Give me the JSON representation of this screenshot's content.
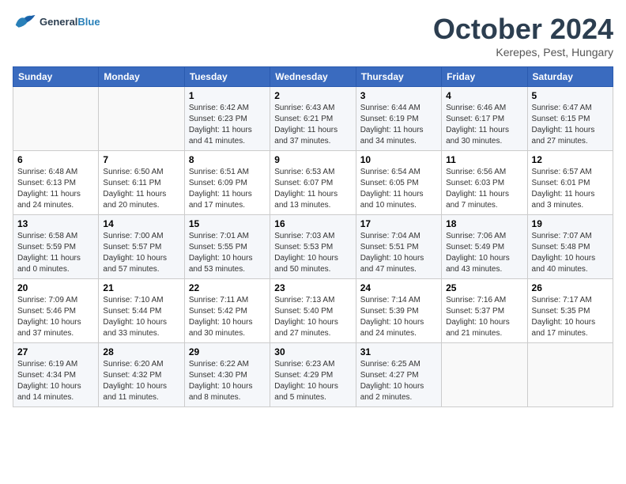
{
  "header": {
    "logo_general": "General",
    "logo_blue": "Blue",
    "month": "October 2024",
    "location": "Kerepes, Pest, Hungary"
  },
  "weekdays": [
    "Sunday",
    "Monday",
    "Tuesday",
    "Wednesday",
    "Thursday",
    "Friday",
    "Saturday"
  ],
  "weeks": [
    [
      {
        "day": "",
        "details": ""
      },
      {
        "day": "",
        "details": ""
      },
      {
        "day": "1",
        "details": "Sunrise: 6:42 AM\nSunset: 6:23 PM\nDaylight: 11 hours and 41 minutes."
      },
      {
        "day": "2",
        "details": "Sunrise: 6:43 AM\nSunset: 6:21 PM\nDaylight: 11 hours and 37 minutes."
      },
      {
        "day": "3",
        "details": "Sunrise: 6:44 AM\nSunset: 6:19 PM\nDaylight: 11 hours and 34 minutes."
      },
      {
        "day": "4",
        "details": "Sunrise: 6:46 AM\nSunset: 6:17 PM\nDaylight: 11 hours and 30 minutes."
      },
      {
        "day": "5",
        "details": "Sunrise: 6:47 AM\nSunset: 6:15 PM\nDaylight: 11 hours and 27 minutes."
      }
    ],
    [
      {
        "day": "6",
        "details": "Sunrise: 6:48 AM\nSunset: 6:13 PM\nDaylight: 11 hours and 24 minutes."
      },
      {
        "day": "7",
        "details": "Sunrise: 6:50 AM\nSunset: 6:11 PM\nDaylight: 11 hours and 20 minutes."
      },
      {
        "day": "8",
        "details": "Sunrise: 6:51 AM\nSunset: 6:09 PM\nDaylight: 11 hours and 17 minutes."
      },
      {
        "day": "9",
        "details": "Sunrise: 6:53 AM\nSunset: 6:07 PM\nDaylight: 11 hours and 13 minutes."
      },
      {
        "day": "10",
        "details": "Sunrise: 6:54 AM\nSunset: 6:05 PM\nDaylight: 11 hours and 10 minutes."
      },
      {
        "day": "11",
        "details": "Sunrise: 6:56 AM\nSunset: 6:03 PM\nDaylight: 11 hours and 7 minutes."
      },
      {
        "day": "12",
        "details": "Sunrise: 6:57 AM\nSunset: 6:01 PM\nDaylight: 11 hours and 3 minutes."
      }
    ],
    [
      {
        "day": "13",
        "details": "Sunrise: 6:58 AM\nSunset: 5:59 PM\nDaylight: 11 hours and 0 minutes."
      },
      {
        "day": "14",
        "details": "Sunrise: 7:00 AM\nSunset: 5:57 PM\nDaylight: 10 hours and 57 minutes."
      },
      {
        "day": "15",
        "details": "Sunrise: 7:01 AM\nSunset: 5:55 PM\nDaylight: 10 hours and 53 minutes."
      },
      {
        "day": "16",
        "details": "Sunrise: 7:03 AM\nSunset: 5:53 PM\nDaylight: 10 hours and 50 minutes."
      },
      {
        "day": "17",
        "details": "Sunrise: 7:04 AM\nSunset: 5:51 PM\nDaylight: 10 hours and 47 minutes."
      },
      {
        "day": "18",
        "details": "Sunrise: 7:06 AM\nSunset: 5:49 PM\nDaylight: 10 hours and 43 minutes."
      },
      {
        "day": "19",
        "details": "Sunrise: 7:07 AM\nSunset: 5:48 PM\nDaylight: 10 hours and 40 minutes."
      }
    ],
    [
      {
        "day": "20",
        "details": "Sunrise: 7:09 AM\nSunset: 5:46 PM\nDaylight: 10 hours and 37 minutes."
      },
      {
        "day": "21",
        "details": "Sunrise: 7:10 AM\nSunset: 5:44 PM\nDaylight: 10 hours and 33 minutes."
      },
      {
        "day": "22",
        "details": "Sunrise: 7:11 AM\nSunset: 5:42 PM\nDaylight: 10 hours and 30 minutes."
      },
      {
        "day": "23",
        "details": "Sunrise: 7:13 AM\nSunset: 5:40 PM\nDaylight: 10 hours and 27 minutes."
      },
      {
        "day": "24",
        "details": "Sunrise: 7:14 AM\nSunset: 5:39 PM\nDaylight: 10 hours and 24 minutes."
      },
      {
        "day": "25",
        "details": "Sunrise: 7:16 AM\nSunset: 5:37 PM\nDaylight: 10 hours and 21 minutes."
      },
      {
        "day": "26",
        "details": "Sunrise: 7:17 AM\nSunset: 5:35 PM\nDaylight: 10 hours and 17 minutes."
      }
    ],
    [
      {
        "day": "27",
        "details": "Sunrise: 6:19 AM\nSunset: 4:34 PM\nDaylight: 10 hours and 14 minutes."
      },
      {
        "day": "28",
        "details": "Sunrise: 6:20 AM\nSunset: 4:32 PM\nDaylight: 10 hours and 11 minutes."
      },
      {
        "day": "29",
        "details": "Sunrise: 6:22 AM\nSunset: 4:30 PM\nDaylight: 10 hours and 8 minutes."
      },
      {
        "day": "30",
        "details": "Sunrise: 6:23 AM\nSunset: 4:29 PM\nDaylight: 10 hours and 5 minutes."
      },
      {
        "day": "31",
        "details": "Sunrise: 6:25 AM\nSunset: 4:27 PM\nDaylight: 10 hours and 2 minutes."
      },
      {
        "day": "",
        "details": ""
      },
      {
        "day": "",
        "details": ""
      }
    ]
  ]
}
